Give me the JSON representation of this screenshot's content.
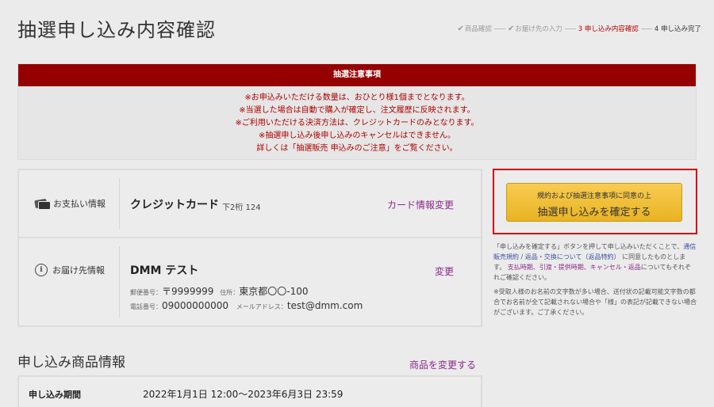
{
  "page_title": "抽選申し込み内容確認",
  "steps": [
    {
      "label": "商品確認",
      "state": "done"
    },
    {
      "label": "お届け先の入力",
      "state": "done"
    },
    {
      "label": "3 申し込み内容確認",
      "state": "active"
    },
    {
      "label": "4 申し込み完了",
      "state": "todo"
    }
  ],
  "notice": {
    "title": "抽選注意事項",
    "lines": [
      "※お申込みいただける数量は、おひとり様1個までとなります。",
      "※当選した場合は自動で購入が確定し、注文履歴に反映されます。",
      "※ご利用いただける決済方法は、クレジットカードのみとなります。",
      "※抽選申し込み後申し込みのキャンセルはできません。",
      "詳しくは「抽選販売 申込みのご注意」をご覧ください。"
    ]
  },
  "payment": {
    "label": "お支払い情報",
    "method": "クレジットカード",
    "detail": "下2桁 124",
    "change_link": "カード情報変更"
  },
  "delivery": {
    "label": "お届け先情報",
    "name": "DMM テスト",
    "postal_label": "郵便番号：",
    "postal": "〒9999999",
    "address_label": "住所：",
    "address": "東京都〇〇-100",
    "phone_label": "電話番号：",
    "phone": "09000000000",
    "email_label": "メールアドレス：",
    "email": "test@dmm.com",
    "change_link": "変更"
  },
  "confirm": {
    "sub": "規約および抽選注意事項に同意の上",
    "main": "抽選申し込みを確定する"
  },
  "terms": {
    "t1": "「申し込みを確定する」ボタンを押して申し込みいただくことで、",
    "l1": "通信販売規約",
    "sep": " / ",
    "l2": "返品・交換について（返品特約）",
    "t2": " に同意したものとします。",
    "p1": "支払時期",
    "p2": "引渡・提供時期",
    "p3": "キャンセル・返品",
    "dot": "、",
    "t3": "についてもそれぞれご確認ください。",
    "note": "※受取人様のお名前の文字数が多い場合、送付状の記載可能文字数の都合でお名前が全て記載されない場合や「様」の表記が記載できない場合がございます。ご了承ください。"
  },
  "product_section": {
    "title": "申し込み商品情報",
    "change_link": "商品を変更する",
    "period_label": "申し込み期間",
    "period_value": "2022年1月1日 12:00〜2023年6月3日 23:59"
  },
  "colors": {
    "accent_red": "#950000",
    "link_purple": "#8a2a8a",
    "button_yellow": "#f5c33b"
  }
}
